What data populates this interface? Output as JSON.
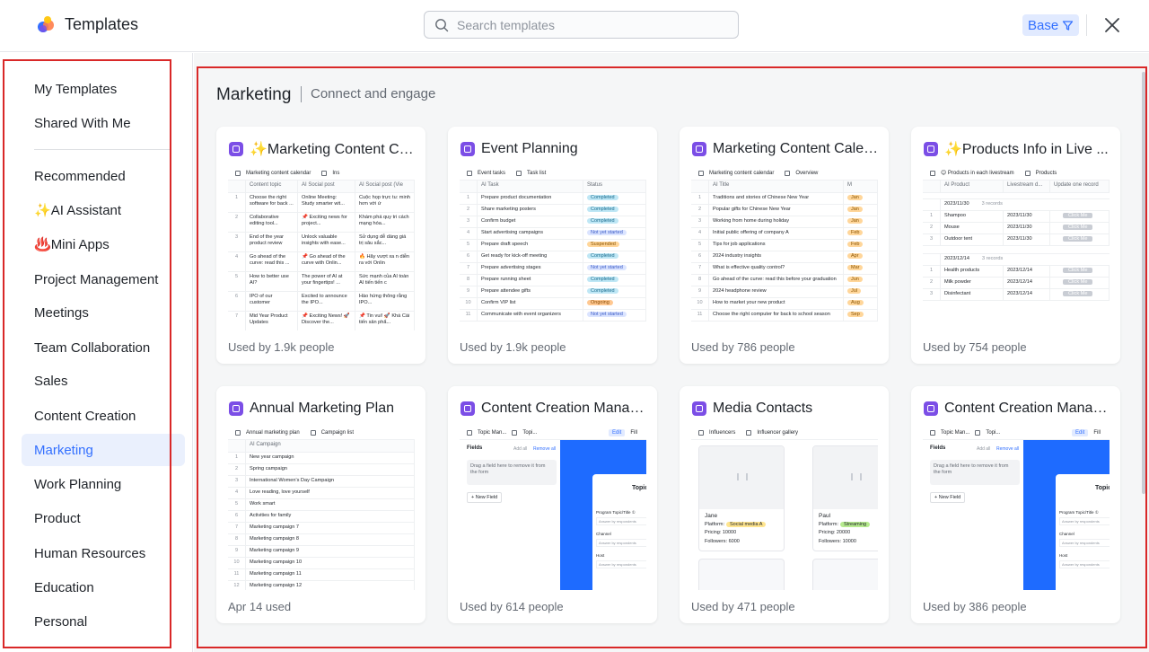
{
  "header": {
    "app_title": "Templates",
    "search_placeholder": "Search templates",
    "filter_label": "Base"
  },
  "sidebar": {
    "top_items": [
      "My Templates",
      "Shared With Me"
    ],
    "categories": [
      {
        "label": "Recommended",
        "prefix": ""
      },
      {
        "label": "AI Assistant",
        "prefix": "✨"
      },
      {
        "label": "Mini Apps",
        "prefix": "♨️ "
      },
      {
        "label": "Project Management",
        "prefix": ""
      },
      {
        "label": "Meetings",
        "prefix": ""
      },
      {
        "label": "Team Collaboration",
        "prefix": ""
      },
      {
        "label": "Sales",
        "prefix": ""
      },
      {
        "label": "Content Creation",
        "prefix": ""
      },
      {
        "label": "Marketing",
        "prefix": "",
        "active": true
      },
      {
        "label": "Work Planning",
        "prefix": ""
      },
      {
        "label": "Product",
        "prefix": ""
      },
      {
        "label": "Human Resources",
        "prefix": ""
      },
      {
        "label": "Education",
        "prefix": ""
      },
      {
        "label": "Personal",
        "prefix": ""
      }
    ]
  },
  "section": {
    "title": "Marketing",
    "subtitle": "Connect and engage"
  },
  "cards": [
    {
      "title": "✨Marketing Content Ca...",
      "usage": "Used by 1.9k people",
      "preview": {
        "kind": "table",
        "table_name": "Marketing content calendar",
        "view": "Ins",
        "columns": [
          "Content topic",
          "AI Social post",
          "AI Social post (Vie"
        ],
        "rows": [
          [
            "1",
            "Choose the right software for back ...",
            "Online Meeting: Study smarter wit...",
            "Cuộc họp trực tu: minh hơn với ứ"
          ],
          [
            "2",
            "Collaborative editing tool...",
            "📌 Exciting news for project...",
            "Khám phá quy tri cách mạng hóa..."
          ],
          [
            "3",
            "End of the year product review",
            "Unlock valuable insights with ease...",
            "Sử dụng dễ dàng giá trị sâu sắc..."
          ],
          [
            "4",
            "Go ahead of the curve: read this ...",
            "📌 Go ahead of the curve with Onlin...",
            "🔥 Hãy vượt xa n diễn ra với Onlin"
          ],
          [
            "5",
            "How to better use AI?",
            "The power of AI at your fingertips! ...",
            "Sức mạnh của AI toàn AI tiến tiến c"
          ],
          [
            "6",
            "IPO of our customer",
            "Excited to announce the IPO...",
            "Hào hứng thông rằng IPO..."
          ],
          [
            "7",
            "Mid Year Product Updates",
            "📌 Exciting News! 🚀 Discover the...",
            "📌 Tin vui! 🚀 Khá Cài tiến sản phẩ..."
          ]
        ]
      }
    },
    {
      "title": "Event Planning",
      "usage": "Used by 1.9k people",
      "preview": {
        "kind": "status",
        "table_name": "Event tasks",
        "view": "Task list",
        "columns": [
          "AI Task",
          "Status"
        ],
        "rows": [
          [
            "1",
            "Prepare product documentation",
            "Completed"
          ],
          [
            "2",
            "Share marketing posters",
            "Completed"
          ],
          [
            "3",
            "Confirm budget",
            "Completed"
          ],
          [
            "4",
            "Start advertising campaigns",
            "Not yet started"
          ],
          [
            "5",
            "Prepare draft speech",
            "Suspended"
          ],
          [
            "6",
            "Get ready for kick-off meeting",
            "Completed"
          ],
          [
            "7",
            "Prepare advertising stages",
            "Not yet started"
          ],
          [
            "8",
            "Prepare running sheet",
            "Completed"
          ],
          [
            "9",
            "Prepare attendee gifts",
            "Completed"
          ],
          [
            "10",
            "Confirm VIP list",
            "Ongoing"
          ],
          [
            "11",
            "Communicate with event organizers",
            "Not yet started"
          ]
        ]
      }
    },
    {
      "title": "Marketing Content Calen...",
      "usage": "Used by 786 people",
      "preview": {
        "kind": "table2",
        "table_name": "Marketing content calendar",
        "view": "Overview",
        "columns": [
          "AI Title",
          "M"
        ],
        "rows": [
          [
            "1",
            "Traditions and stories of Chinese New Year",
            "Jan"
          ],
          [
            "2",
            "Popular gifts for Chinese New Year",
            "Jan"
          ],
          [
            "3",
            "Working from home during holiday",
            "Jan"
          ],
          [
            "4",
            "Initial public offering of company A",
            "Feb"
          ],
          [
            "5",
            "Tips for job applications",
            "Feb"
          ],
          [
            "6",
            "2024 industry insights",
            "Apr"
          ],
          [
            "7",
            "What is effective quality control?",
            "Mar"
          ],
          [
            "8",
            "Go ahead of the curve: read this before your graduation",
            "Jun"
          ],
          [
            "9",
            "2024 headphone review",
            "Jul"
          ],
          [
            "10",
            "How to market your new product",
            "Aug"
          ],
          [
            "11",
            "Choose the right computer for back to school season",
            "Sep"
          ]
        ]
      }
    },
    {
      "title": "✨Products Info in Live ...",
      "usage": "Used by 754 people",
      "preview": {
        "kind": "grouped",
        "table_name": "😊 Products in each livestream",
        "view": "Products",
        "columns": [
          "AI Product",
          "Livestream d...",
          "Update one record"
        ],
        "groups": [
          {
            "label": "2023/11/30",
            "count": "3 records",
            "rows": [
              [
                "1",
                "Shampoo",
                "2023/11/30",
                "Click Me"
              ],
              [
                "2",
                "Mouse",
                "2023/11/30",
                "Click Me"
              ],
              [
                "3",
                "Outdoor tent",
                "2023/11/30",
                "Click Me"
              ]
            ]
          },
          {
            "label": "2023/12/14",
            "count": "3 records",
            "rows": [
              [
                "1",
                "Health products",
                "2023/12/14",
                "Click Me"
              ],
              [
                "2",
                "Milk powder",
                "2023/12/14",
                "Click Me"
              ],
              [
                "3",
                "Disinfectant",
                "2023/12/14",
                "Click Me"
              ]
            ]
          }
        ]
      }
    },
    {
      "title": "Annual Marketing Plan",
      "usage": "Apr 14 used",
      "preview": {
        "kind": "list",
        "table_name": "Annual marketing plan",
        "view": "Campaign list",
        "columns": [
          "AI Campaign"
        ],
        "rows": [
          [
            "1",
            "New year campaign"
          ],
          [
            "2",
            "Spring campaign"
          ],
          [
            "3",
            "International Women's Day Campaign"
          ],
          [
            "4",
            "Love reading, love yourself"
          ],
          [
            "5",
            "Work smart"
          ],
          [
            "6",
            "Activities for family"
          ],
          [
            "7",
            "Marketing campaign 7"
          ],
          [
            "8",
            "Marketing campaign 8"
          ],
          [
            "9",
            "Marketing campaign 9"
          ],
          [
            "10",
            "Marketing campaign 10"
          ],
          [
            "11",
            "Marketing campaign 11"
          ],
          [
            "12",
            "Marketing campaign 12"
          ]
        ]
      }
    },
    {
      "title": "Content Creation Manag...",
      "usage": "Used by 614 people",
      "preview": {
        "kind": "form",
        "table_name": "Topic Man...",
        "view": "Topi...",
        "edit": "Edit",
        "fill": "Fill",
        "fields": "Fields",
        "add_all": "Add all",
        "remove_all": "Remove all",
        "drag_hint": "Drag a field here to remove it from the form",
        "new_field": "+ New Field",
        "sheet_title": "Topic",
        "sheet_fields": [
          "Program Topic/Title ①",
          "Channel",
          "Host"
        ],
        "sheet_hint": "Answer by respondents"
      }
    },
    {
      "title": "Media Contacts",
      "usage": "Used by 471 people",
      "preview": {
        "kind": "gallery",
        "table_name": "Influencers",
        "view": "Influencer gallery",
        "items": [
          {
            "name": "Jane",
            "platform_label": "Platform:",
            "platform": "Social media A",
            "platform_color": "#ffe58f",
            "pricing": "Pricing: 10000",
            "followers": "Followers: 6000"
          },
          {
            "name": "Paul",
            "platform_label": "Platform:",
            "platform": "Streaming",
            "platform_color": "#b7eb8f",
            "pricing": "Pricing: 20000",
            "followers": "Followers: 10000"
          }
        ]
      }
    },
    {
      "title": "Content Creation Manag...",
      "usage": "Used by 386 people",
      "preview": {
        "kind": "form",
        "table_name": "Topic Man...",
        "view": "Topi...",
        "edit": "Edit",
        "fill": "Fill",
        "fields": "Fields",
        "add_all": "Add all",
        "remove_all": "Remove all",
        "drag_hint": "Drag a field here to remove it from the form",
        "new_field": "+ New Field",
        "sheet_title": "Topic",
        "sheet_fields": [
          "Program Topic/Title ①",
          "Channel",
          "Host"
        ],
        "sheet_hint": "Answer by respondents"
      }
    }
  ],
  "colors": {
    "accent": "#3370ff",
    "base_icon": "#7b4ee6",
    "highlight_box": "#d92828"
  }
}
